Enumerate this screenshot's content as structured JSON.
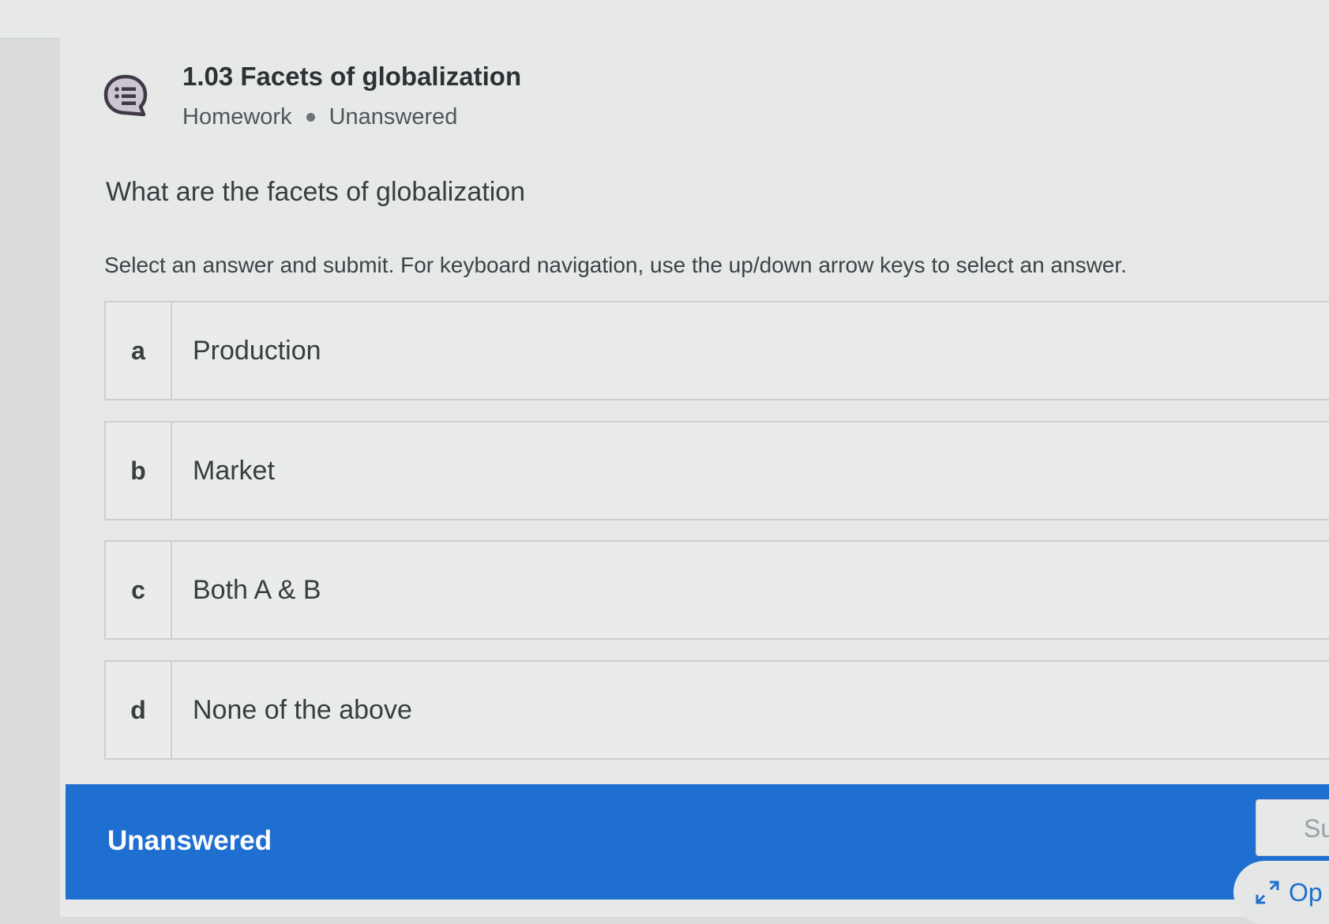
{
  "assignment": {
    "title": "1.03 Facets of globalization",
    "type": "Homework",
    "status": "Unanswered",
    "icon": "list-speech-bubble-icon"
  },
  "question": {
    "prompt": "What are the facets of globalization",
    "instructions": "Select an answer and submit. For keyboard navigation, use the up/down arrow keys to select an answer.",
    "options": [
      {
        "letter": "a",
        "text": "Production"
      },
      {
        "letter": "b",
        "text": "Market"
      },
      {
        "letter": "c",
        "text": "Both A & B"
      },
      {
        "letter": "d",
        "text": "None of the above"
      }
    ]
  },
  "footer": {
    "status_label": "Unanswered",
    "submit_label": "Su",
    "open_label": "Op",
    "open_icon": "expand-icon",
    "accent_color": "#1f6fd0"
  }
}
